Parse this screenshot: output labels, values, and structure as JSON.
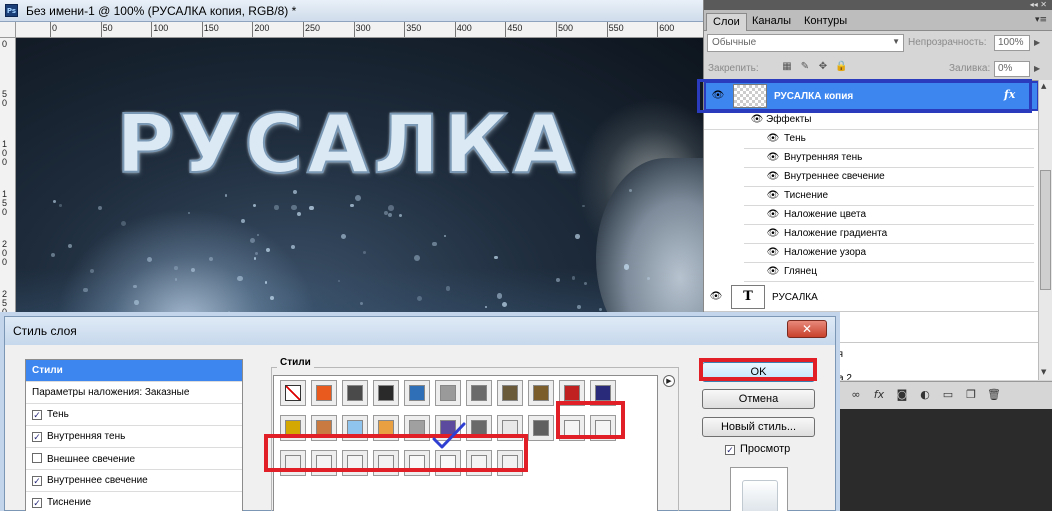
{
  "document": {
    "title": "Без имени-1 @ 100% (РУСАЛКА копия, RGB/8) *",
    "app_badge": "Ps",
    "canvas_text": "РУСАЛКА",
    "ruler_h_labels": [
      "0",
      "50",
      "100",
      "150",
      "200",
      "250",
      "300",
      "350",
      "400",
      "450",
      "500",
      "550",
      "600",
      "650"
    ],
    "ruler_v_labels": [
      "0",
      "5 0",
      "1 0 0",
      "1 5 0",
      "2 0 0",
      "2 5 0"
    ]
  },
  "layers_panel": {
    "tabs": [
      {
        "label": "Слои",
        "active": true
      },
      {
        "label": "Каналы",
        "active": false
      },
      {
        "label": "Контуры",
        "active": false
      }
    ],
    "blend_mode": "Обычные",
    "opacity_label": "Непрозрачность:",
    "opacity_value": "100%",
    "lock_label": "Закрепить:",
    "fill_label": "Заливка:",
    "fill_value": "0%",
    "layers": [
      {
        "name": "РУСАЛКА копия",
        "selected": true,
        "fx": "fx"
      },
      {
        "name": "РУСАЛКА",
        "selected": false,
        "type_glyph": "T"
      }
    ],
    "effects_header": "Эффекты",
    "effects": [
      "Тень",
      "Внутренняя тень",
      "Внутреннее свечение",
      "Тиснение",
      "Наложение цвета",
      "Наложение градиента",
      "Наложение узора",
      "Глянец"
    ],
    "partial_text_1": "ия",
    "partial_text_2": "а 2"
  },
  "layer_style_dialog": {
    "title": "Стиль слоя",
    "close_glyph": "✕",
    "left_items": [
      {
        "label": "Стили",
        "selected": true
      },
      {
        "label": "Параметры наложения: Заказные",
        "selected": false
      },
      {
        "label": "Тень",
        "checked": true
      },
      {
        "label": "Внутренняя тень",
        "checked": true
      },
      {
        "label": "Внешнее свечение",
        "checked": false
      },
      {
        "label": "Внутреннее свечение",
        "checked": true
      },
      {
        "label": "Тиснение",
        "checked": true
      }
    ],
    "styles_group_label": "Стили",
    "buttons": {
      "ok": "OK",
      "cancel": "Отмена",
      "new_style": "Новый стиль..."
    },
    "preview_label": "Просмотр",
    "preview_checked": true,
    "check_glyph": "✓",
    "menu_glyph": "▶"
  },
  "colors": {
    "selection_blue": "#3d86f0",
    "highlight_red": "#e01f27",
    "highlight_navy": "#2b3bbd"
  }
}
